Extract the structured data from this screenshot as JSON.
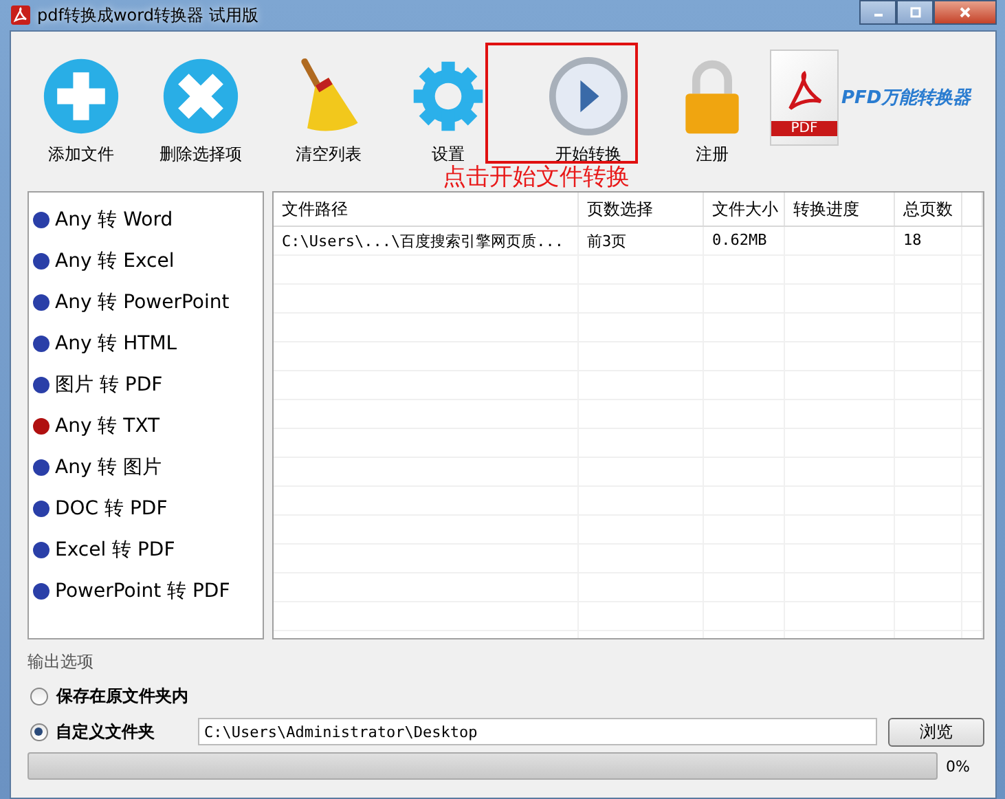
{
  "window": {
    "title": "pdf转换成word转换器 试用版"
  },
  "toolbar": [
    {
      "kind": "add",
      "label": "添加文件"
    },
    {
      "kind": "delete",
      "label": "删除选择项"
    },
    {
      "kind": "clear",
      "label": "清空列表"
    },
    {
      "kind": "settings",
      "label": "设置"
    },
    {
      "kind": "start",
      "label": "开始转换"
    },
    {
      "kind": "register",
      "label": "注册"
    }
  ],
  "logo": {
    "badge": "PDF",
    "text": "PFD万能转换器"
  },
  "annotation": {
    "text": "点击开始文件转换"
  },
  "sidebar": {
    "items": [
      {
        "label": "Any 转 Word",
        "color": "#2a3fa8"
      },
      {
        "label": "Any 转 Excel",
        "color": "#2a3fa8"
      },
      {
        "label": "Any 转 PowerPoint",
        "color": "#2a3fa8"
      },
      {
        "label": "Any 转 HTML",
        "color": "#2a3fa8"
      },
      {
        "label": "图片 转 PDF",
        "color": "#2a3fa8"
      },
      {
        "label": "Any 转 TXT",
        "color": "#b01010"
      },
      {
        "label": "Any 转 图片",
        "color": "#2a3fa8"
      },
      {
        "label": "DOC 转 PDF",
        "color": "#2a3fa8"
      },
      {
        "label": "Excel 转 PDF",
        "color": "#2a3fa8"
      },
      {
        "label": "PowerPoint 转 PDF",
        "color": "#2a3fa8"
      }
    ]
  },
  "table": {
    "columns": [
      "文件路径",
      "页数选择",
      "文件大小",
      "转换进度",
      "总页数"
    ],
    "rows": [
      [
        "C:\\Users\\...\\百度搜索引擎网页质...",
        "前3页",
        "0.62MB",
        "",
        "18"
      ]
    ]
  },
  "output": {
    "title": "输出选项",
    "options": [
      {
        "label": "保存在原文件夹内",
        "selected": false
      },
      {
        "label": "自定义文件夹",
        "selected": true
      }
    ],
    "path": "C:\\Users\\Administrator\\Desktop",
    "browse": "浏览"
  },
  "progress": {
    "level": 0,
    "reading": "0%"
  }
}
